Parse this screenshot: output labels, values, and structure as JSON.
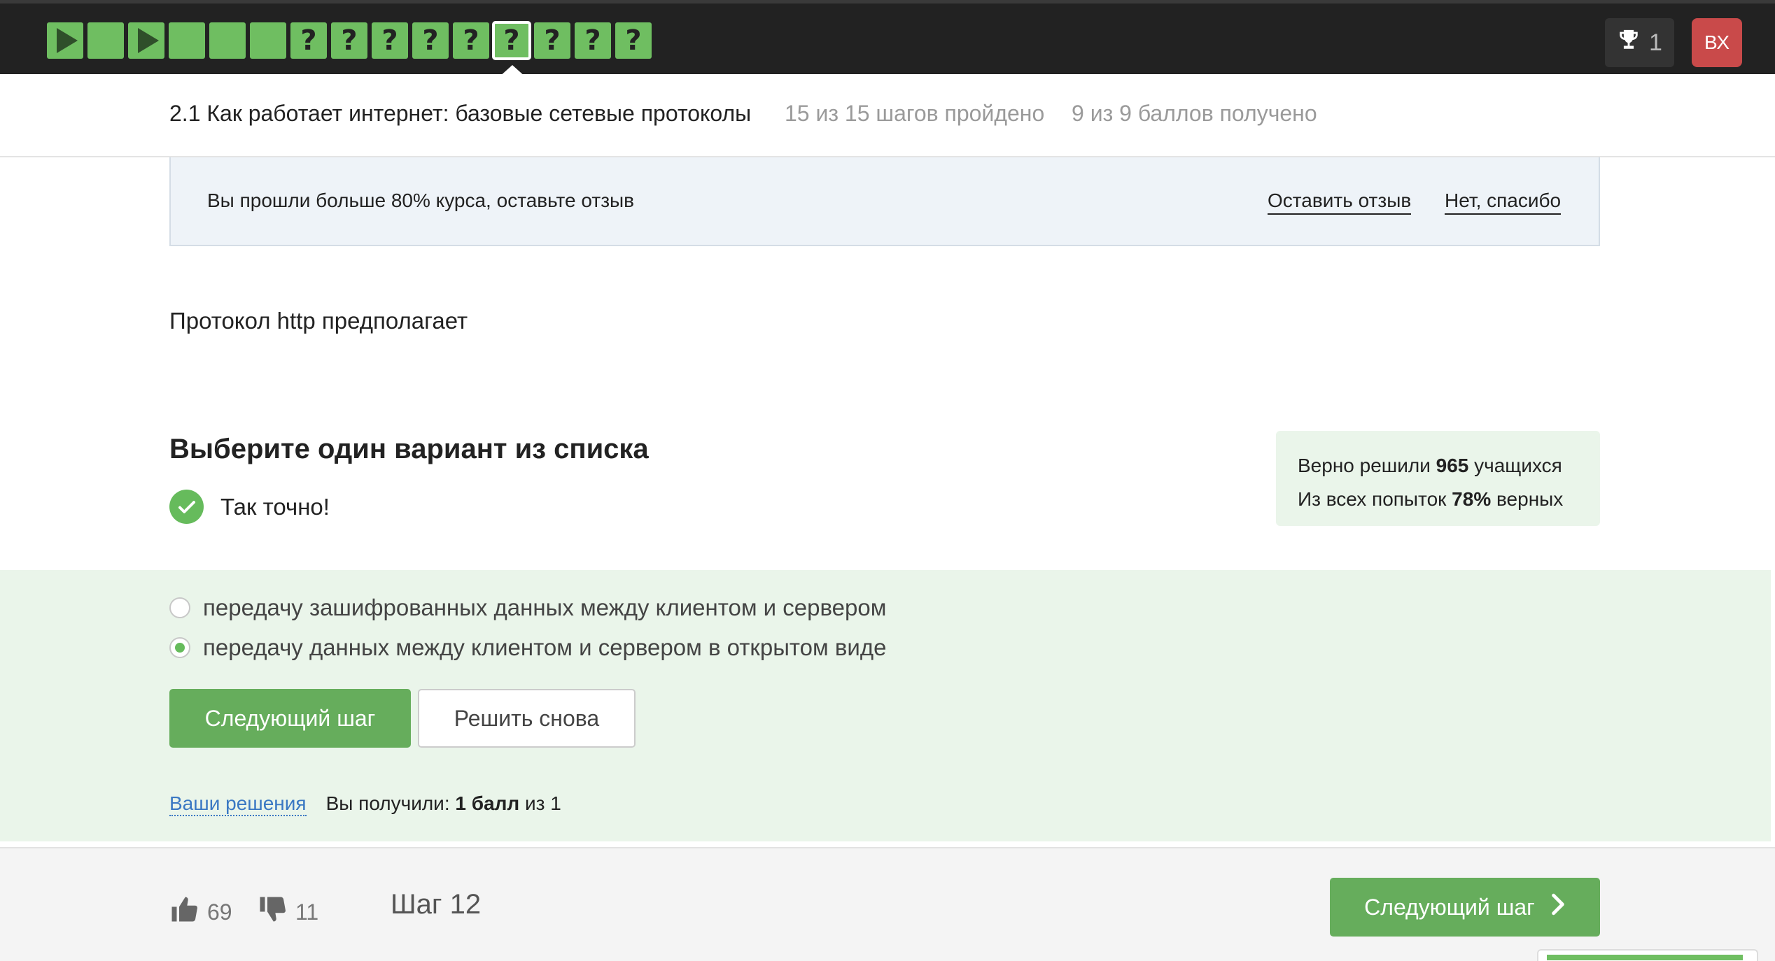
{
  "steps": [
    {
      "kind": "play"
    },
    {
      "kind": "text"
    },
    {
      "kind": "play"
    },
    {
      "kind": "text"
    },
    {
      "kind": "text"
    },
    {
      "kind": "text"
    },
    {
      "kind": "quiz"
    },
    {
      "kind": "quiz"
    },
    {
      "kind": "quiz"
    },
    {
      "kind": "quiz"
    },
    {
      "kind": "quiz"
    },
    {
      "kind": "quiz",
      "current": true
    },
    {
      "kind": "quiz"
    },
    {
      "kind": "quiz"
    },
    {
      "kind": "quiz"
    }
  ],
  "step_quiz_mark": "?",
  "topbar": {
    "trophy_count": "1",
    "avatar_initials": "ВХ"
  },
  "lesson": {
    "title": "2.1 Как работает интернет: базовые сетевые протоколы",
    "steps_progress": "15 из 15 шагов пройдено",
    "points_progress": "9 из 9 баллов  получено"
  },
  "banner": {
    "text": "Вы прошли больше 80% курса, оставьте отзыв",
    "leave_review": "Оставить отзыв",
    "no_thanks": "Нет, спасибо"
  },
  "question": "Протокол http предполагает",
  "quiz": {
    "instruction": "Выберите один вариант из списка",
    "feedback": "Так точно!",
    "stats": {
      "solved_prefix": "Верно решили ",
      "solved_count": "965",
      "solved_suffix": " учащихся",
      "attempts_prefix": "Из всех попыток ",
      "attempts_percent": "78%",
      "attempts_suffix": " верных"
    },
    "options": [
      {
        "label": "передачу зашифрованных данных между клиентом и сервером",
        "selected": false
      },
      {
        "label": "передачу данных между клиентом и сервером в открытом виде",
        "selected": true
      }
    ],
    "next_button": "Следующий шаг",
    "retry_button": "Решить снова",
    "your_solutions": "Ваши решения",
    "result_prefix": "Вы получили: ",
    "result_points": "1 балл",
    "result_suffix": " из 1"
  },
  "footer": {
    "likes": "69",
    "dislikes": "11",
    "step_label": "Шаг 12",
    "next_button": "Следующий шаг"
  },
  "colors": {
    "accent_green": "#66ad5c",
    "step_green": "#6fbe61",
    "avatar_red": "#c94a4a",
    "link_blue": "#3a78c3"
  }
}
